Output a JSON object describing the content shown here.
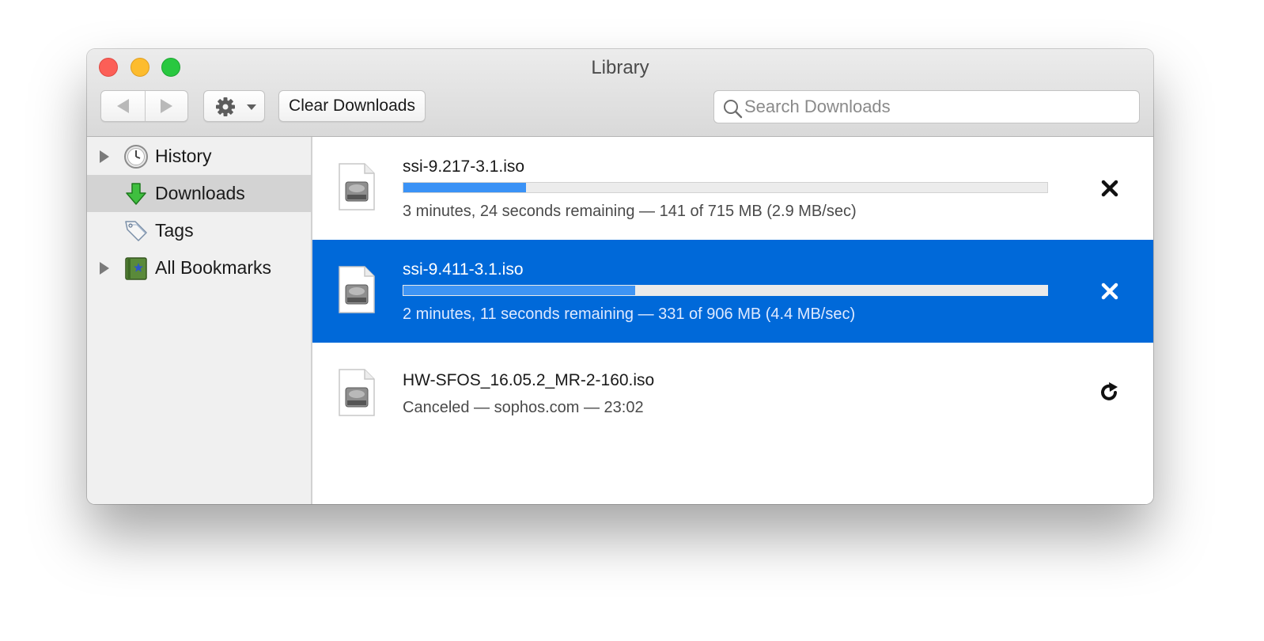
{
  "window": {
    "title": "Library"
  },
  "toolbar": {
    "back_icon": "back-arrow-icon",
    "forward_icon": "forward-arrow-icon",
    "action_icon": "gear-icon",
    "clear_label": "Clear Downloads",
    "search_placeholder": "Search Downloads",
    "search_value": ""
  },
  "sidebar": {
    "items": [
      {
        "label": "History",
        "icon": "clock-icon",
        "expandable": true,
        "selected": false
      },
      {
        "label": "Downloads",
        "icon": "download-arrow-icon",
        "expandable": false,
        "selected": true
      },
      {
        "label": "Tags",
        "icon": "tag-icon",
        "expandable": false,
        "selected": false
      },
      {
        "label": "All Bookmarks",
        "icon": "bookmarks-book-icon",
        "expandable": true,
        "selected": false
      }
    ]
  },
  "downloads": [
    {
      "name": "ssi-9.217-3.1.iso",
      "progress": 0.19,
      "status": "3 minutes, 24 seconds remaining — 141 of 715 MB (2.9 MB/sec)",
      "action": "cancel",
      "action_icon": "close-icon",
      "selected": false
    },
    {
      "name": "ssi-9.411-3.1.iso",
      "progress": 0.36,
      "status": "2 minutes, 11 seconds remaining — 331 of 906 MB (4.4 MB/sec)",
      "action": "cancel",
      "action_icon": "close-icon",
      "selected": true
    },
    {
      "name": "HW-SFOS_16.05.2_MR-2-160.iso",
      "status": "Canceled — sophos.com — 23:02",
      "action": "retry",
      "action_icon": "retry-icon",
      "selected": false
    }
  ],
  "colors": {
    "selection": "#0069d9",
    "progress_fill": "#3a92f6",
    "close": "#fc5f57",
    "minimize": "#fdbc2e",
    "maximize": "#29c840"
  }
}
